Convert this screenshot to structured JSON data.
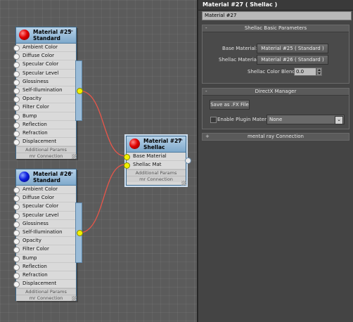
{
  "panel": {
    "title": "Material #27  ( Shellac )",
    "name_field": "Material #27",
    "rollouts": {
      "shellac": {
        "toggle": "-",
        "title": "Shellac Basic Parameters",
        "base_label": "Base Material:",
        "base_value": "Material #25  ( Standard )",
        "shellac_label": "Shellac Material:",
        "shellac_value": "Material #26  ( Standard )",
        "blend_label": "Shellac Color Blend:",
        "blend_value": "0.0"
      },
      "directx": {
        "toggle": "-",
        "title": "DirectX Manager",
        "save_label": "Save as .FX File",
        "plugin_label": "Enable Plugin Material",
        "plugin_value": "None",
        "plugin_checked": false
      },
      "mentalray": {
        "toggle": "+",
        "title": "mental ray Connection"
      }
    }
  },
  "nodes": {
    "m25": {
      "title_line1": "Material #25",
      "title_line2": "Standard",
      "sphere_color": "#e00000",
      "slots": [
        "Ambient Color",
        "Diffuse Color",
        "Specular Color",
        "Specular Level",
        "Glossiness",
        "Self-Illumination",
        "Opacity",
        "Filter Color",
        "Bump",
        "Reflection",
        "Refraction",
        "Displacement"
      ],
      "footer1": "Additional Params",
      "footer2": "mr Connection",
      "minimize": "—"
    },
    "m26": {
      "title_line1": "Material #26",
      "title_line2": "Standard",
      "sphere_color": "#1020e0",
      "slots": [
        "Ambient Color",
        "Diffuse Color",
        "Specular Color",
        "Specular Level",
        "Glossiness",
        "Self-Illumination",
        "Opacity",
        "Filter Color",
        "Bump",
        "Reflection",
        "Refraction",
        "Displacement"
      ],
      "footer1": "Additional Params",
      "footer2": "mr Connection",
      "minimize": "—"
    },
    "m27": {
      "title_line1": "Material #27",
      "title_line2": "Shellac",
      "sphere_color": "#e00000",
      "slots": [
        "Base Material",
        "Shellac Mat"
      ],
      "footer1": "Additional Params",
      "footer2": "mr Connection",
      "minimize": "—"
    }
  },
  "colors": {
    "wire": "#e8564a",
    "connector_active": "#f2f000",
    "node_header": "#9cc0de"
  }
}
